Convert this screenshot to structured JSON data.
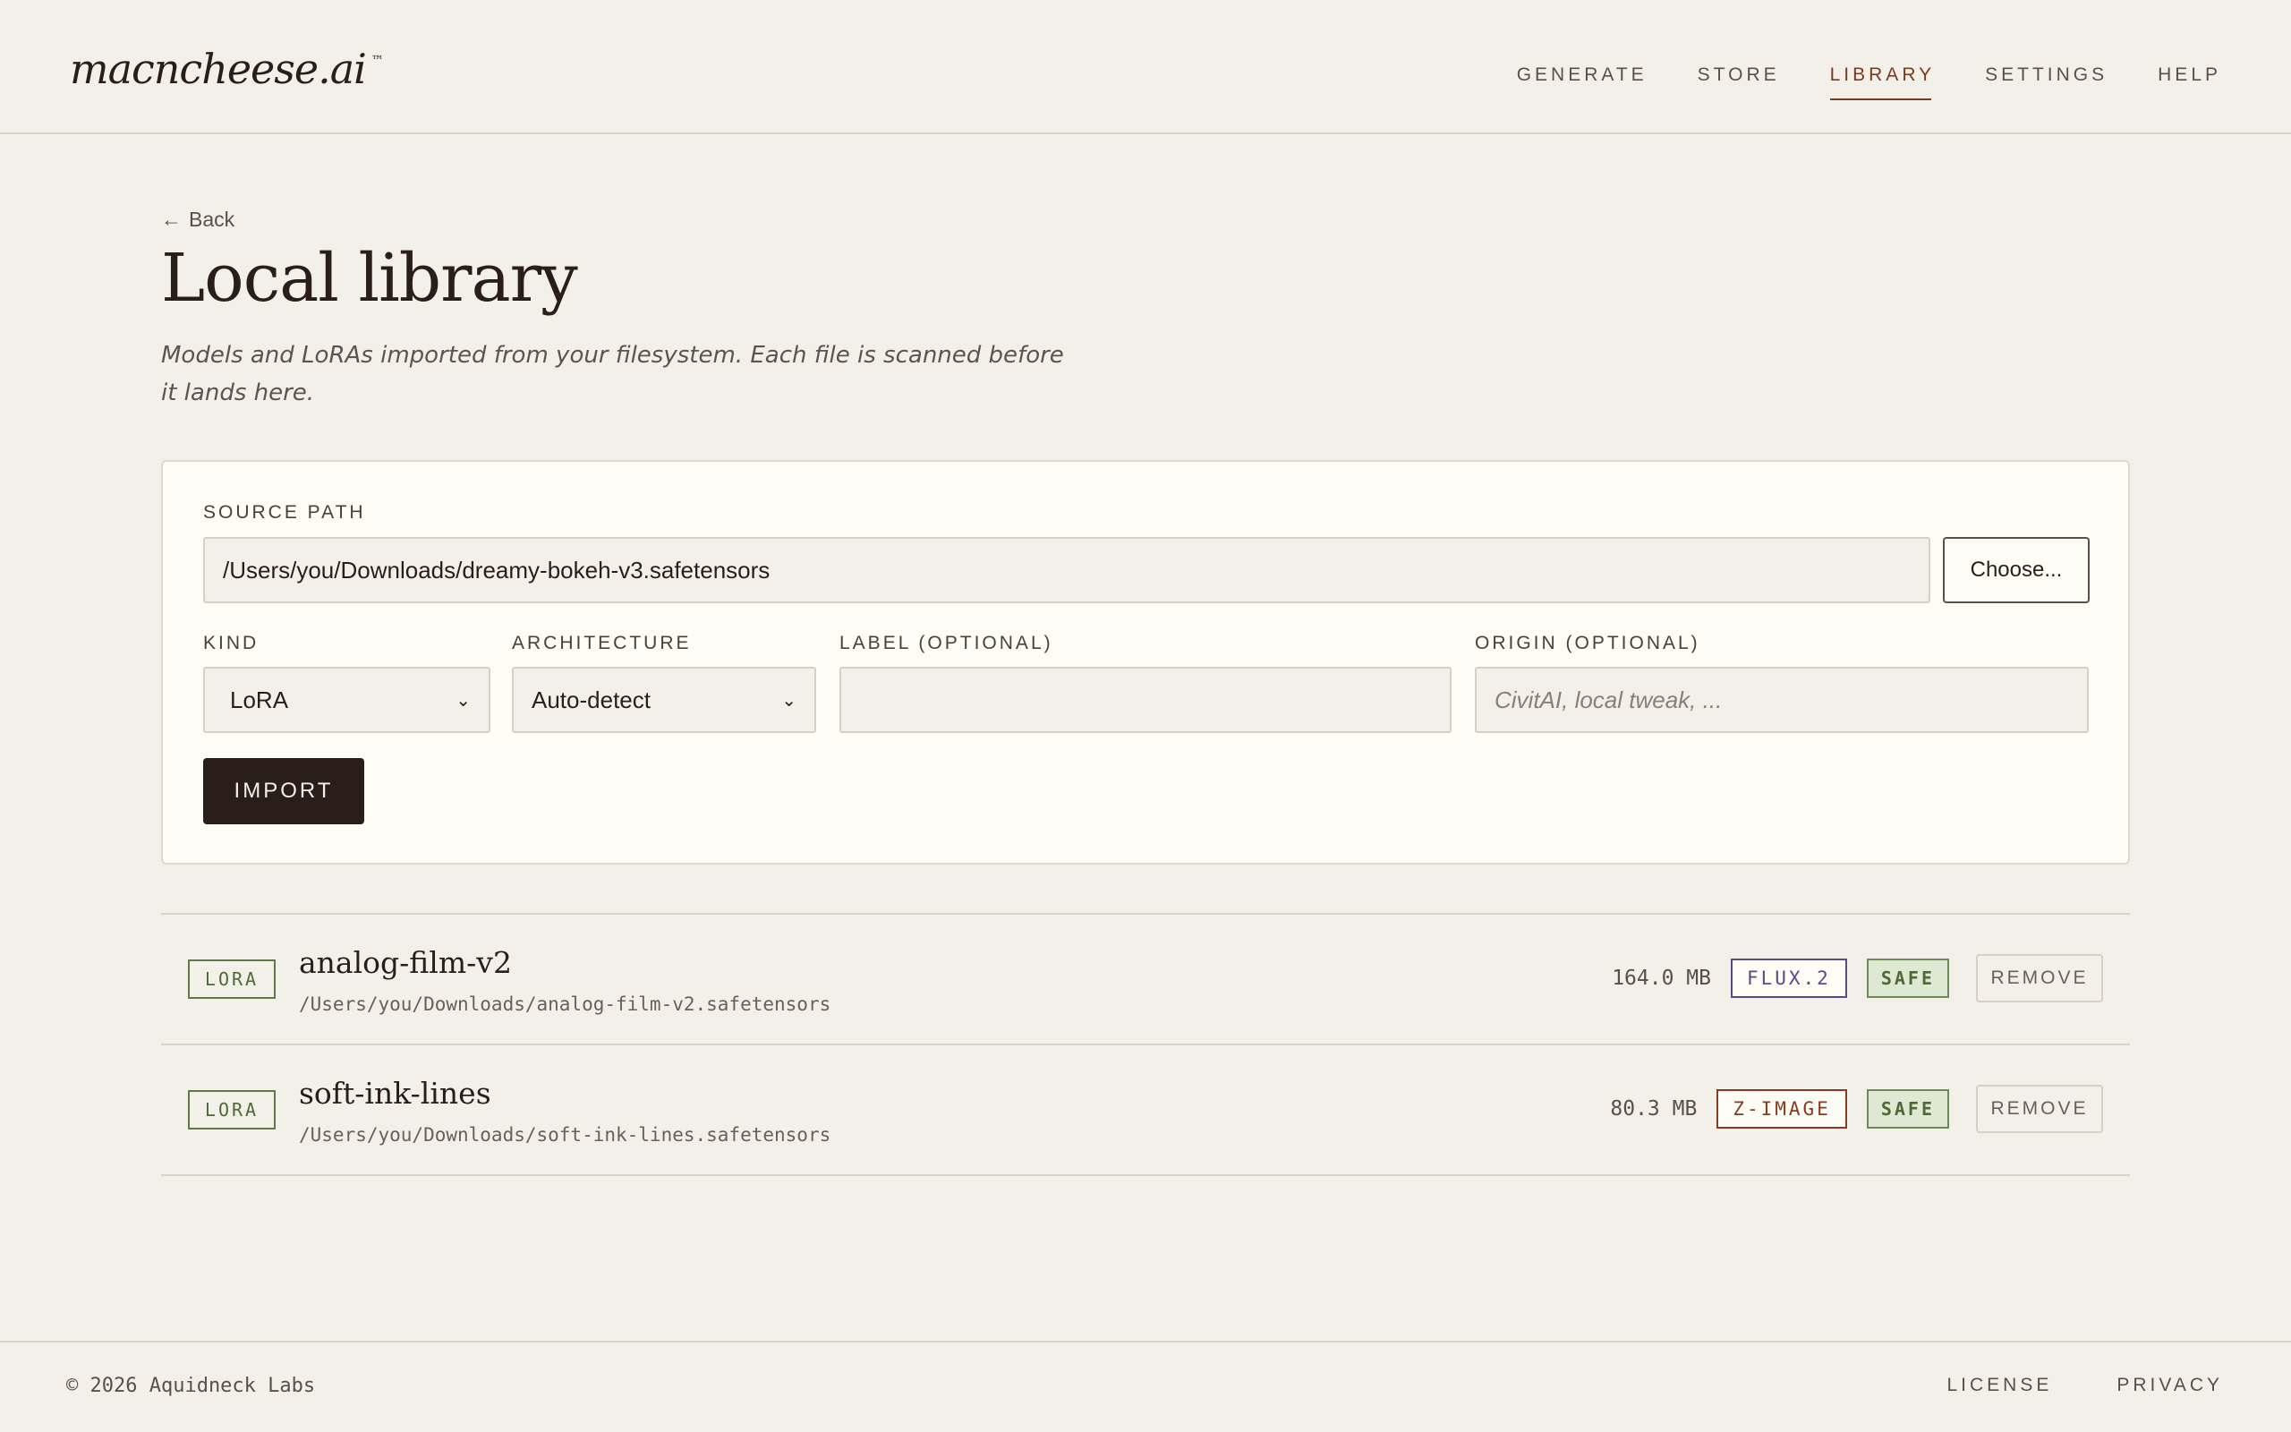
{
  "brand": {
    "name": "macncheese.ai",
    "trademark": "™"
  },
  "nav": {
    "items": [
      {
        "label": "GENERATE",
        "active": false
      },
      {
        "label": "STORE",
        "active": false
      },
      {
        "label": "LIBRARY",
        "active": true
      },
      {
        "label": "SETTINGS",
        "active": false
      },
      {
        "label": "HELP",
        "active": false
      }
    ]
  },
  "page": {
    "back_label": "Back",
    "title": "Local library",
    "subtitle": "Models and LoRAs imported from your filesystem. Each file is scanned before it lands here."
  },
  "import_form": {
    "source_path": {
      "label": "SOURCE PATH",
      "value": "/Users/you/Downloads/dreamy-bokeh-v3.safetensors"
    },
    "choose_label": "Choose...",
    "kind": {
      "label": "KIND",
      "selected": "LoRA"
    },
    "architecture": {
      "label": "ARCHITECTURE",
      "selected": "Auto-detect"
    },
    "label_field": {
      "label": "LABEL (OPTIONAL)",
      "value": ""
    },
    "origin_field": {
      "label": "ORIGIN (OPTIONAL)",
      "placeholder": "CivitAI, local tweak, ..."
    },
    "import_label": "IMPORT"
  },
  "library": {
    "items": [
      {
        "kind": "LORA",
        "name": "analog-film-v2",
        "path": "/Users/you/Downloads/analog-film-v2.safetensors",
        "size": "164.0 MB",
        "arch": "FLUX.2",
        "arch_color": "#5a4a8a",
        "status": "SAFE",
        "remove_label": "REMOVE"
      },
      {
        "kind": "LORA",
        "name": "soft-ink-lines",
        "path": "/Users/you/Downloads/soft-ink-lines.safetensors",
        "size": "80.3 MB",
        "arch": "Z-IMAGE",
        "arch_color": "#8a3a20",
        "status": "SAFE",
        "remove_label": "REMOVE"
      }
    ]
  },
  "footer": {
    "copyright": "© 2026 Aquidneck Labs",
    "links": [
      "LICENSE",
      "PRIVACY"
    ]
  },
  "colors": {
    "accent": "#7a3a20",
    "safe": "#4e6a36",
    "primary_button": "#2a1f18"
  }
}
